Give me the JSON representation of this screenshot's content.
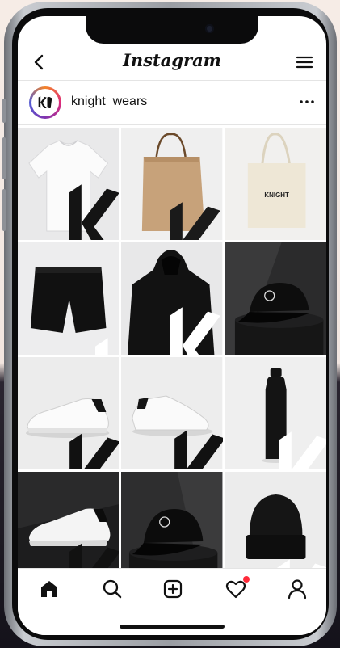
{
  "header": {
    "title": "Instagram"
  },
  "profile": {
    "username": "knight_wears"
  },
  "colors": {
    "accent_red": "#ff2a3a",
    "text": "#111111",
    "frame": "#c9ccd1"
  },
  "posts": [
    {
      "product": "t-shirt",
      "color": "white"
    },
    {
      "product": "paper-bag",
      "color": "kraft"
    },
    {
      "product": "tote-bag",
      "color": "cream",
      "print": "KNIGHT"
    },
    {
      "product": "shorts",
      "color": "black"
    },
    {
      "product": "hoodie",
      "color": "black"
    },
    {
      "product": "cap",
      "color": "black"
    },
    {
      "product": "sneaker",
      "color": "white"
    },
    {
      "product": "sneaker",
      "color": "white"
    },
    {
      "product": "water-bottle",
      "color": "black"
    },
    {
      "product": "sneaker",
      "color": "white"
    },
    {
      "product": "cap",
      "color": "black"
    },
    {
      "product": "beanie",
      "color": "black"
    }
  ],
  "bottom_nav": [
    "home-icon",
    "search-icon",
    "add-post-icon",
    "heart-icon",
    "profile-icon"
  ]
}
